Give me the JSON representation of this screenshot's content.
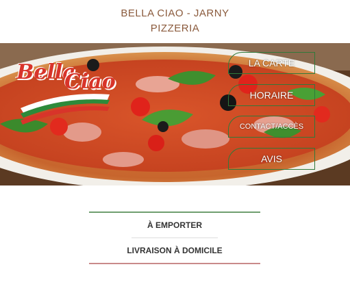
{
  "header": {
    "line1": "BELLA CIAO - JARNY",
    "line2": "PIZZERIA"
  },
  "logo": {
    "text1": "Bella",
    "text2": "Ciao"
  },
  "nav": [
    {
      "label": "LA CARTE"
    },
    {
      "label": "HORAIRE"
    },
    {
      "label": "CONTACT/ACCÈS"
    },
    {
      "label": "AVIS"
    }
  ],
  "links": [
    {
      "label": "À EMPORTER"
    },
    {
      "label": "LIVRAISON À DOMICILE"
    }
  ],
  "colors": {
    "accent_green": "#2f7a3a",
    "header_text": "#8a5a3c",
    "logo_red": "#d8342a"
  }
}
